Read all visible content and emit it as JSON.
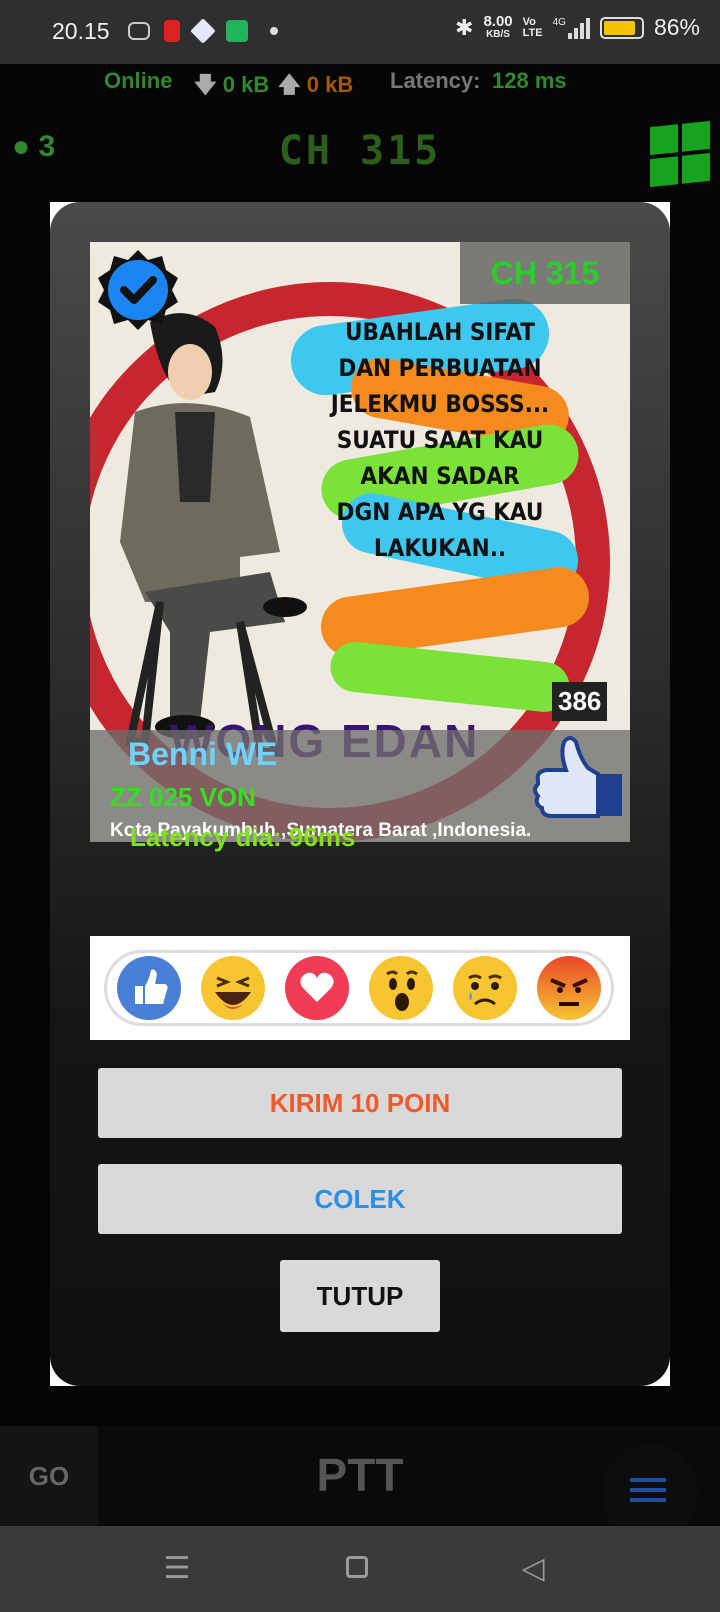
{
  "status_bar": {
    "time": "20.15",
    "speed_value": "8.00",
    "speed_unit": "KB/S",
    "network": "4G",
    "battery_percent": "86%",
    "battery_level": 0.86
  },
  "network_bar": {
    "status": "Online",
    "download": "0 kB",
    "upload": "0 kB",
    "latency_label": "Latency:",
    "latency_value": "128 ms"
  },
  "channel": {
    "user_count": "3",
    "title": "CH 315"
  },
  "profile": {
    "channel_badge": "CH 315",
    "quote": "UBAHLAH SIFAT DAN PERBUATAN JELEKMU BOSSS... SUATU SAAT KAU AKAN SADAR DGN APA YG KAU LAKUKAN..",
    "banner_text": "WONG EDAN",
    "likes": "386",
    "name": "Benni WE",
    "callsign": "ZZ 025 VON",
    "location": "Kota Payakumbuh ,Sumatera Barat ,Indonesia."
  },
  "latency_peer": "Latency dia: 96ms",
  "reactions": [
    "like",
    "haha",
    "love",
    "wow",
    "sad",
    "angry"
  ],
  "buttons": {
    "send_points": "KIRIM 10 POIN",
    "poke": "COLEK",
    "close": "TUTUP"
  },
  "bottom_bar": {
    "go": "GO",
    "ptt": "PTT"
  },
  "colors": {
    "accent_green": "#2f8a2f",
    "send_points": "#f05a2a",
    "poke": "#2a8fe6"
  }
}
